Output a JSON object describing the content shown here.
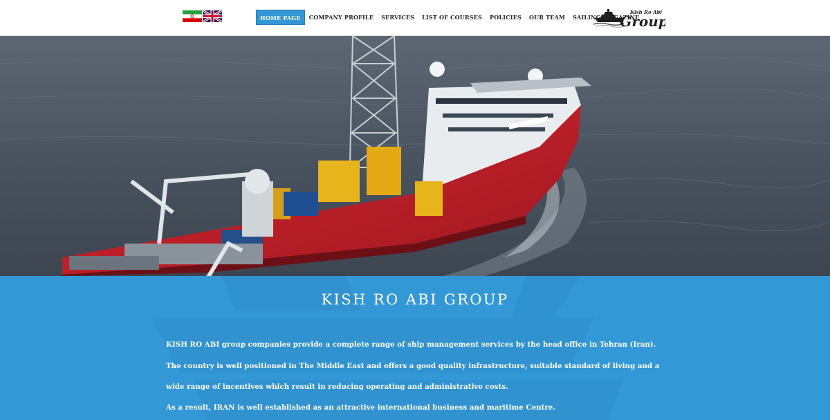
{
  "header": {
    "flags": [
      {
        "name": "iran-flag",
        "language": "Persian"
      },
      {
        "name": "uk-flag",
        "language": "English"
      }
    ],
    "nav": [
      {
        "label": "HOME PAGE",
        "active": true
      },
      {
        "label": "COMPANY PROFILE",
        "active": false
      },
      {
        "label": "SERVICES",
        "active": false
      },
      {
        "label": "LIST OF COURSES",
        "active": false
      },
      {
        "label": "POLICIES",
        "active": false
      },
      {
        "label": "OUR TEAM",
        "active": false
      },
      {
        "label": "SAILING MAGAZINE",
        "active": false
      }
    ],
    "logo": {
      "line1": "Kish Ro Abi",
      "line2": "Group",
      "icon": "ship-icon"
    }
  },
  "hero": {
    "image": "offshore-drilling-vessel-photo"
  },
  "about": {
    "title": "KISH RO ABI GROUP",
    "paragraph1": "KISH RO ABI group companies provide a complete range of ship management services by the head office in Tehran (Iran). The country is well positioned in The Middle East and offers a good quality infrastructure, suitable standard of living and a wide range of incentives which result in reducing operating and administrative costs.",
    "paragraph2": "As a result, IRAN is well established as an attractive international business and maritime Centre."
  },
  "colors": {
    "accent": "#3398d6",
    "nav_active": "#3397d5",
    "ship_hull": "#c7202a",
    "sea": "#4e5864"
  }
}
